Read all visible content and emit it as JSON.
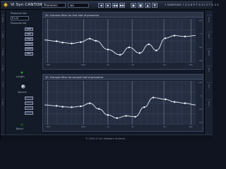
{
  "app": {
    "title": "Vi Syn CANTOR",
    "preset_field": "Phoneme:",
    "preset_value": "wa",
    "toolbar_buttons": [
      "◀",
      "▶",
      "◀◀",
      "▶▶",
      "●",
      "■",
      "▲",
      "▼"
    ],
    "toolbar_info": "1 SAMPLING 7 A 3 8 P T A 3 I S T G 3 E"
  },
  "sidepanel": {
    "phoneme_set_label": "Phoneme Set",
    "phoneme_set_value": "E s N",
    "phoneme_list_label": "Phoneme list",
    "buttons": [
      "Add",
      "Del",
      "Copy",
      "Paste",
      "Undo",
      "Mix"
    ],
    "knob_labels": [
      "Length",
      "Volume",
      "Blend"
    ]
  },
  "left_tabs": [
    "Voice",
    "Edit",
    "Phon",
    "Mix",
    "Fx",
    "Out"
  ],
  "right_tabs": [
    "Song",
    "Lyric",
    "Note",
    "Vibr",
    "Env",
    "Tune"
  ],
  "graphs": [
    {
      "title": "20. Formant filter for first half of phoneme"
    },
    {
      "title": "20. Formant filter for second half of phoneme"
    }
  ],
  "scale_labels": [
    "+12",
    "0",
    "-12",
    "-24"
  ],
  "freq_labels": [
    "100",
    "500",
    "1k",
    "2k",
    "5k",
    "10k"
  ],
  "status": "© 2004 Vi Syn Software Systems",
  "chart_data": [
    {
      "type": "line",
      "series": [
        {
          "values": [
            0.52,
            0.49,
            0.46,
            0.44,
            0.47,
            0.55,
            0.5,
            0.3,
            0.18,
            0.35,
            0.22,
            0.42,
            0.28,
            0.56,
            0.62,
            0.6,
            0.62
          ]
        }
      ],
      "x": [
        0,
        0.08,
        0.12,
        0.18,
        0.24,
        0.3,
        0.34,
        0.42,
        0.5,
        0.56,
        0.63,
        0.69,
        0.74,
        0.8,
        0.86,
        0.93,
        1.0
      ],
      "ylim": [
        0,
        1
      ]
    },
    {
      "type": "line",
      "series": [
        {
          "values": [
            0.45,
            0.43,
            0.41,
            0.4,
            0.42,
            0.49,
            0.36,
            0.22,
            0.15,
            0.2,
            0.18,
            0.4,
            0.62,
            0.58,
            0.52,
            0.49,
            0.45
          ]
        }
      ],
      "x": [
        0,
        0.08,
        0.12,
        0.18,
        0.24,
        0.3,
        0.36,
        0.42,
        0.48,
        0.54,
        0.6,
        0.66,
        0.72,
        0.8,
        0.86,
        0.93,
        1.0
      ],
      "ylim": [
        0,
        1
      ]
    }
  ],
  "colors": {
    "accent": "#f5e27a",
    "curve": "#e8ecf5",
    "grid": "#46516a",
    "led": "#2ad23c"
  }
}
